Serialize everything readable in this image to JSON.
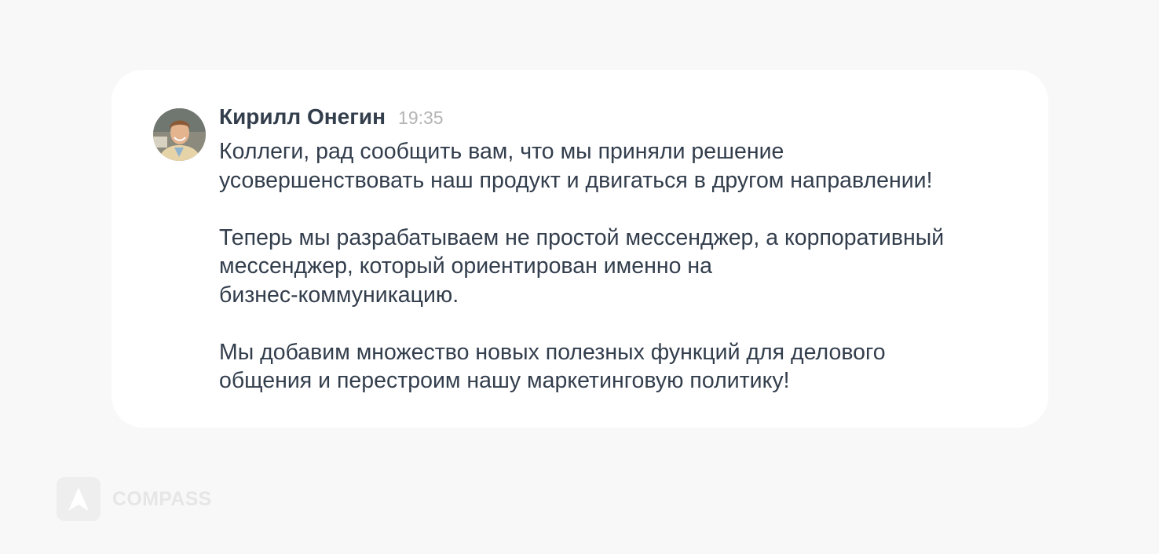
{
  "message": {
    "author": "Кирилл Онегин",
    "time": "19:35",
    "avatar_icon": "person-avatar",
    "paragraphs": [
      [
        "Коллеги, рад сообщить вам, что мы приняли решение",
        "усовершенствовать наш продукт и двигаться в другом направлении!"
      ],
      [
        "Теперь мы разрабатываем не простой мессенджер, а корпоративный",
        "мессенджер, который ориентирован именно на",
        "бизнес-коммуникацию."
      ],
      [
        "Мы добавим множество новых полезных функций для делового",
        "общения и перестроим нашу маркетинговую политику!"
      ]
    ]
  },
  "brand": {
    "name": "COMPASS",
    "logo_icon": "compass-logo-icon"
  },
  "colors": {
    "background": "#f8f8f8",
    "card": "#ffffff",
    "text": "#333e4d",
    "time": "#b4b4b4",
    "brand_watermark": "#e6e6e6"
  }
}
